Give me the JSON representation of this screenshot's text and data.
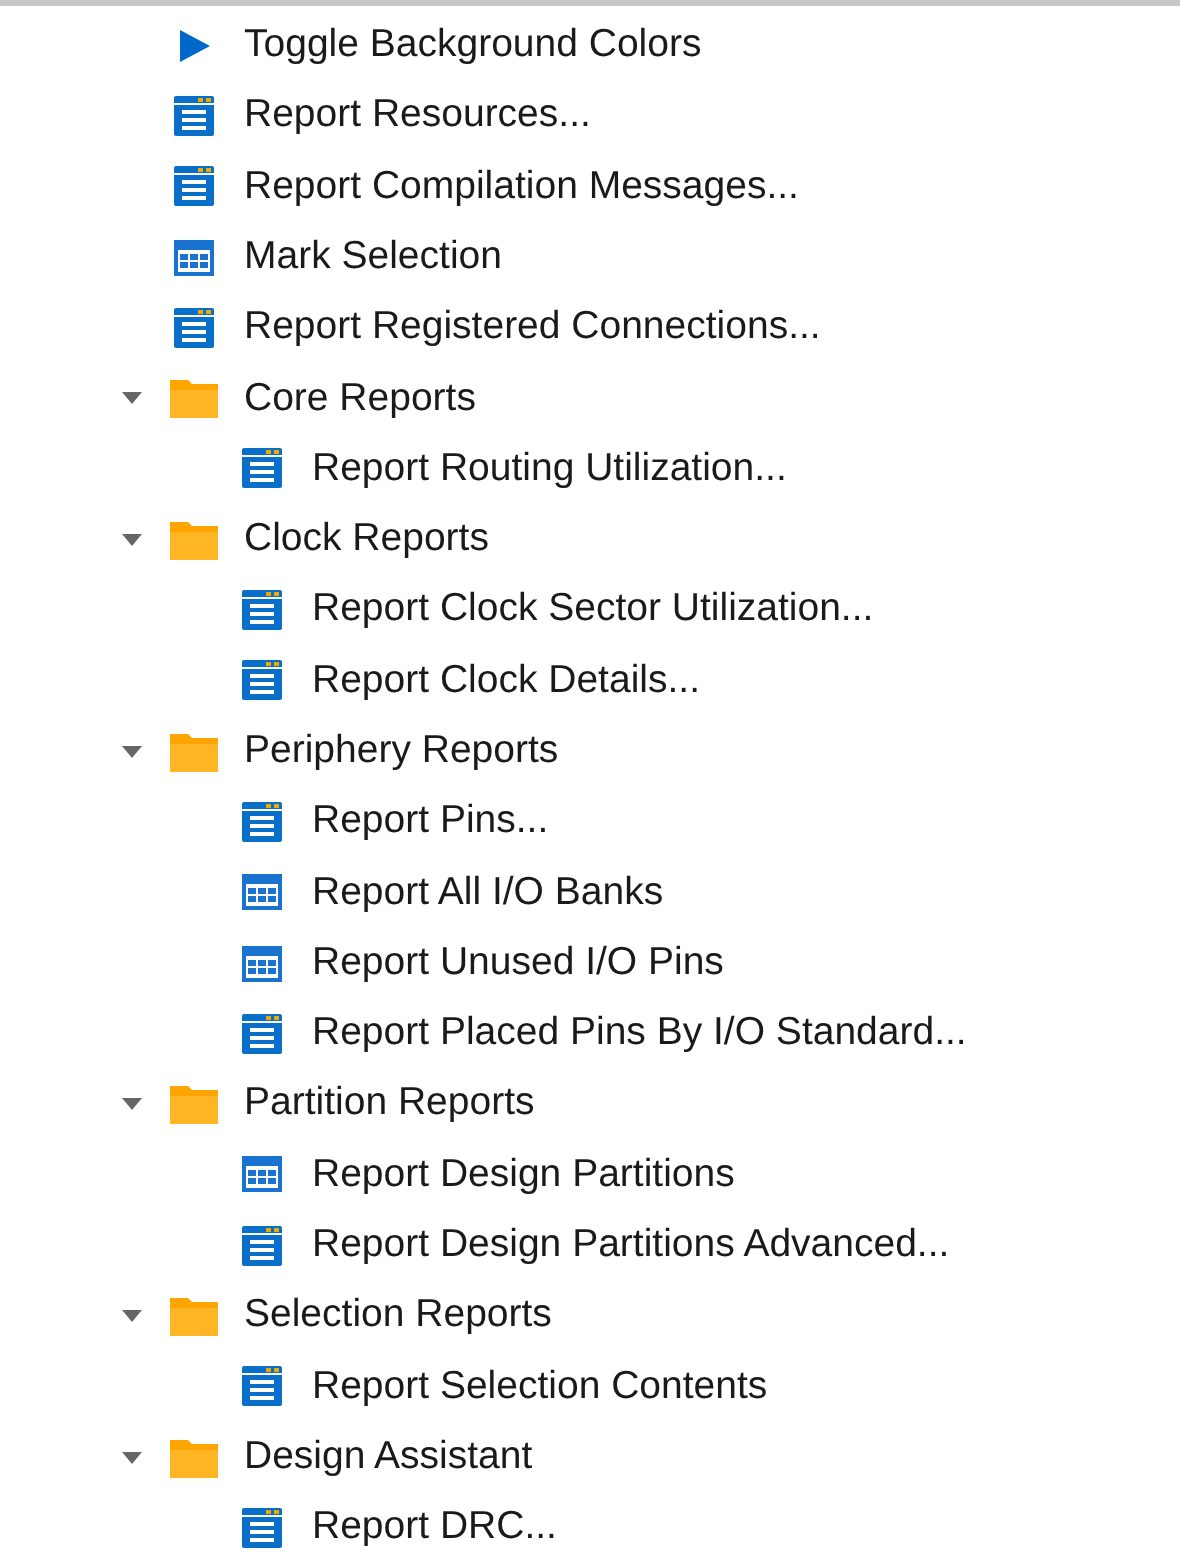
{
  "tree": {
    "items": [
      {
        "kind": "run",
        "label": "Toggle Background Colors"
      },
      {
        "kind": "report",
        "label": "Report Resources..."
      },
      {
        "kind": "report",
        "label": "Report Compilation Messages..."
      },
      {
        "kind": "table",
        "label": "Mark Selection"
      },
      {
        "kind": "report",
        "label": "Report Registered Connections..."
      },
      {
        "kind": "folder",
        "label": "Core Reports",
        "expanded": true,
        "children": [
          {
            "kind": "report",
            "label": "Report Routing Utilization..."
          }
        ]
      },
      {
        "kind": "folder",
        "label": "Clock Reports",
        "expanded": true,
        "children": [
          {
            "kind": "report",
            "label": "Report Clock Sector Utilization..."
          },
          {
            "kind": "report",
            "label": "Report Clock Details..."
          }
        ]
      },
      {
        "kind": "folder",
        "label": "Periphery Reports",
        "expanded": true,
        "children": [
          {
            "kind": "report",
            "label": "Report Pins..."
          },
          {
            "kind": "table",
            "label": "Report All I/O Banks"
          },
          {
            "kind": "table",
            "label": "Report Unused I/O Pins"
          },
          {
            "kind": "report",
            "label": "Report Placed Pins By I/O Standard..."
          }
        ]
      },
      {
        "kind": "folder",
        "label": "Partition Reports",
        "expanded": true,
        "children": [
          {
            "kind": "table",
            "label": "Report Design Partitions"
          },
          {
            "kind": "report",
            "label": "Report Design Partitions Advanced..."
          }
        ]
      },
      {
        "kind": "folder",
        "label": "Selection Reports",
        "expanded": true,
        "children": [
          {
            "kind": "report",
            "label": "Report Selection Contents"
          }
        ]
      },
      {
        "kind": "folder",
        "label": "Design Assistant",
        "expanded": true,
        "children": [
          {
            "kind": "report",
            "label": "Report DRC..."
          }
        ]
      }
    ]
  }
}
